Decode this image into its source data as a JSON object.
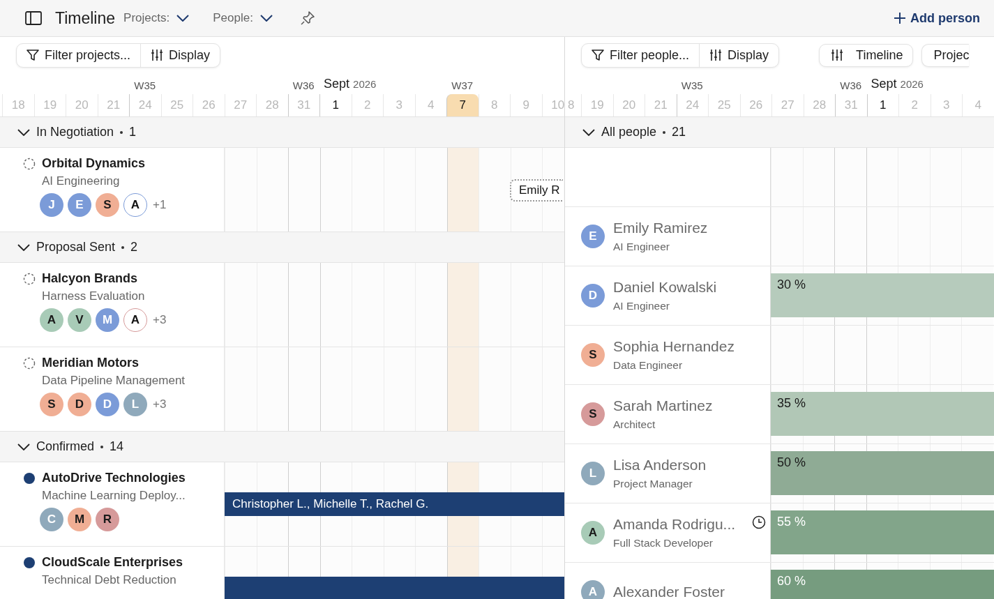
{
  "topbar": {
    "title": "Timeline",
    "filters": [
      {
        "label": "Projects:"
      },
      {
        "label": "People:"
      }
    ],
    "add_button": "Add person"
  },
  "projects_pane": {
    "toolbar": {
      "filter": "Filter projects...",
      "display": "Display"
    },
    "days": [
      {
        "label": "18"
      },
      {
        "label": "19"
      },
      {
        "label": "20"
      },
      {
        "label": "21"
      },
      {
        "label": "24",
        "week": "W35"
      },
      {
        "label": "25"
      },
      {
        "label": "26"
      },
      {
        "label": "27"
      },
      {
        "label": "28"
      },
      {
        "label": "31",
        "week": "W36"
      },
      {
        "label": "1",
        "month": "Sept",
        "year": "2026"
      },
      {
        "label": "2"
      },
      {
        "label": "3"
      },
      {
        "label": "4"
      },
      {
        "label": "7",
        "week": "W37",
        "today": true
      },
      {
        "label": "8"
      },
      {
        "label": "9"
      },
      {
        "label": "10"
      }
    ],
    "groups": [
      {
        "name": "In Negotiation",
        "count": "1",
        "expanded": true,
        "projects": [
          {
            "name": "Orbital Dynamics",
            "subtitle": "AI Engineering",
            "confirmed": false,
            "avatars": [
              {
                "letter": "J",
                "color": "#7b9bd8",
                "outlined": false
              },
              {
                "letter": "E",
                "color": "#7b9bd8",
                "outlined": false
              },
              {
                "letter": "S",
                "color": "#f0ae94",
                "outlined": false
              },
              {
                "letter": "A",
                "color": "#7b9bd8",
                "outlined": true
              }
            ],
            "extra": "+1",
            "bars": [
              {
                "kind": "placeholder",
                "label": "Emily R"
              }
            ]
          }
        ]
      },
      {
        "name": "Proposal Sent",
        "count": "2",
        "expanded": true,
        "projects": [
          {
            "name": "Halcyon Brands",
            "subtitle": "Harness Evaluation",
            "confirmed": false,
            "avatars": [
              {
                "letter": "A",
                "color": "#a8cbb7",
                "outlined": false
              },
              {
                "letter": "V",
                "color": "#a8cbb7",
                "outlined": false
              },
              {
                "letter": "M",
                "color": "#7b9bd8",
                "outlined": false
              },
              {
                "letter": "A",
                "color": "#d69a9a",
                "outlined": true
              }
            ],
            "extra": "+3"
          },
          {
            "name": "Meridian Motors",
            "subtitle": "Data Pipeline Management",
            "confirmed": false,
            "avatars": [
              {
                "letter": "S",
                "color": "#f0ae94",
                "outlined": false
              },
              {
                "letter": "D",
                "color": "#f0ae94",
                "outlined": false
              },
              {
                "letter": "D",
                "color": "#7b9bd8",
                "outlined": false
              },
              {
                "letter": "L",
                "color": "#8fa9bb",
                "outlined": false
              }
            ],
            "extra": "+3"
          }
        ]
      },
      {
        "name": "Confirmed",
        "count": "14",
        "expanded": true,
        "projects": [
          {
            "name": "AutoDrive Technologies",
            "subtitle": "Machine Learning Deploy...",
            "confirmed": true,
            "avatars": [
              {
                "letter": "C",
                "color": "#8fa9bb",
                "outlined": false
              },
              {
                "letter": "M",
                "color": "#f0ae94",
                "outlined": false
              },
              {
                "letter": "R",
                "color": "#d69a9a",
                "outlined": false
              }
            ],
            "bars": [
              {
                "kind": "booked",
                "label": "Christopher L., Michelle T., Rachel G."
              }
            ]
          },
          {
            "name": "CloudScale Enterprises",
            "subtitle": "Technical Debt Reduction",
            "confirmed": true,
            "bars": [
              {
                "kind": "booked"
              }
            ]
          }
        ]
      }
    ]
  },
  "people_pane": {
    "toolbar": {
      "filter": "Filter people...",
      "display": "Display",
      "buttons": [
        "Timeline",
        "Projec"
      ]
    },
    "days": [
      {
        "label": "8",
        "partial": true
      },
      {
        "label": "19"
      },
      {
        "label": "20"
      },
      {
        "label": "21"
      },
      {
        "label": "24",
        "week": "W35"
      },
      {
        "label": "25"
      },
      {
        "label": "26"
      },
      {
        "label": "27"
      },
      {
        "label": "28"
      },
      {
        "label": "31",
        "week": "W36"
      },
      {
        "label": "1",
        "month": "Sept",
        "year": "2026"
      },
      {
        "label": "2"
      },
      {
        "label": "3"
      },
      {
        "label": "4"
      }
    ],
    "group": {
      "name": "All people",
      "count": "21",
      "expanded": true
    },
    "people": [
      {
        "name": "Emily Ramirez",
        "role": "AI Engineer",
        "initial": "E",
        "color": "#7b9bd8",
        "has_clock": false
      },
      {
        "name": "Daniel Kowalski",
        "role": "AI Engineer",
        "initial": "D",
        "color": "#7b9bd8",
        "has_clock": false,
        "allocation": {
          "label": "30 %",
          "color": "#b6cbbc"
        }
      },
      {
        "name": "Sophia Hernandez",
        "role": "Data Engineer",
        "initial": "S",
        "color": "#f0ae94",
        "has_clock": false
      },
      {
        "name": "Sarah Martinez",
        "role": "Architect",
        "initial": "S",
        "color": "#d69a9a",
        "has_clock": false,
        "allocation": {
          "label": "35 %",
          "color": "#b1c7b6"
        }
      },
      {
        "name": "Lisa Anderson",
        "role": "Project Manager",
        "initial": "L",
        "color": "#8fa9bb",
        "has_clock": false,
        "allocation": {
          "label": "50 %",
          "color": "#8fab95"
        }
      },
      {
        "name": "Amanda Rodrigu...",
        "role": "Full Stack Developer",
        "initial": "A",
        "color": "#a8cbb7",
        "has_clock": true,
        "allocation": {
          "label": "55 %",
          "color": "#82a58a"
        }
      },
      {
        "name": "Alexander Foster",
        "initial": "A",
        "color": "#8fa9bb",
        "has_clock": false,
        "allocation": {
          "label": "60 %",
          "color": "#769c7f"
        }
      }
    ]
  }
}
